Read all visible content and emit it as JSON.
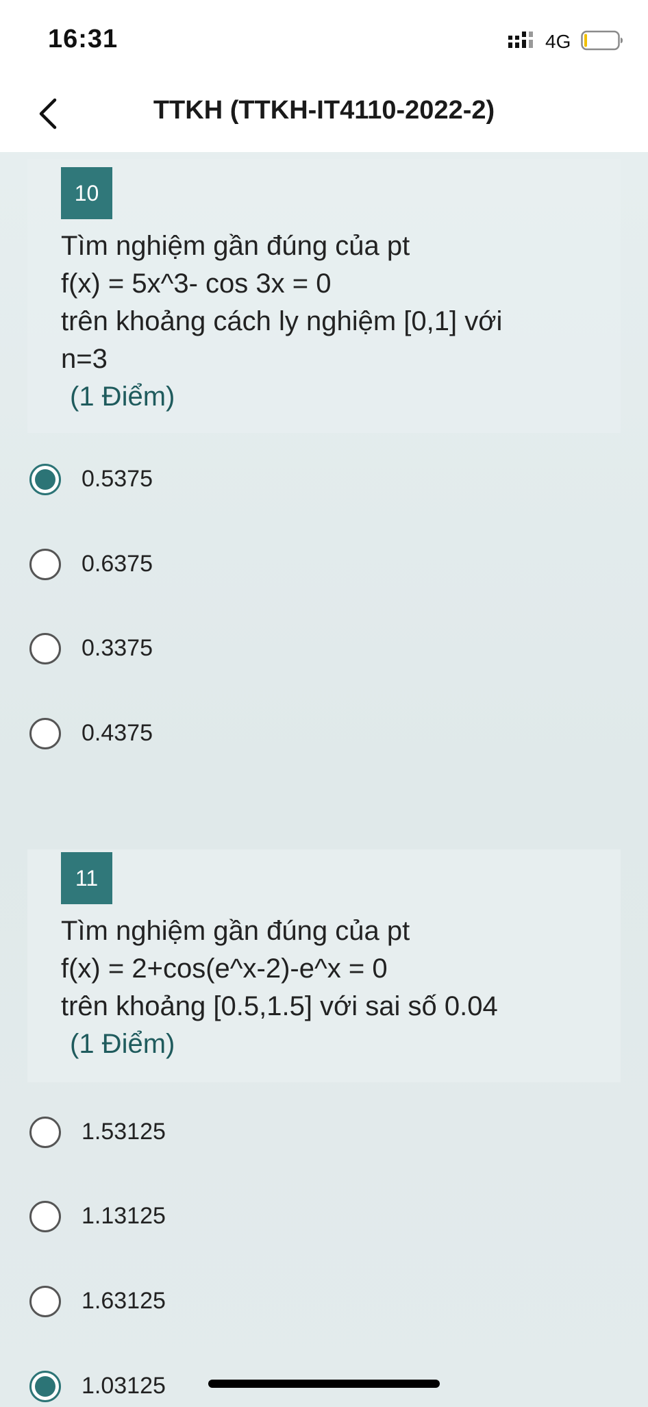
{
  "status_bar": {
    "time": "16:31",
    "network": "4G",
    "icons": [
      "signal-icon",
      "battery-icon"
    ]
  },
  "nav": {
    "back_icon": "chevron-left-icon",
    "title": "TTKH (TTKH-IT4110-2022-2)"
  },
  "questions": [
    {
      "number": "10",
      "lines": [
        "Tìm nghiệm gần đúng của pt",
        "f(x) = 5x^3- cos 3x = 0",
        "trên khoảng cách ly nghiệm [0,1] với",
        "n=3"
      ],
      "points": "(1 Điểm)",
      "options": [
        {
          "label": "0.5375",
          "selected": true
        },
        {
          "label": "0.6375",
          "selected": false
        },
        {
          "label": "0.3375",
          "selected": false
        },
        {
          "label": "0.4375",
          "selected": false
        }
      ]
    },
    {
      "number": "11",
      "lines": [
        "Tìm nghiệm gần đúng của pt",
        "f(x) = 2+cos(e^x-2)-e^x = 0",
        "trên khoảng [0.5,1.5] với sai số 0.04"
      ],
      "points": "(1 Điểm)",
      "options": [
        {
          "label": "1.53125",
          "selected": false
        },
        {
          "label": "1.13125",
          "selected": false
        },
        {
          "label": "1.63125",
          "selected": false
        },
        {
          "label": "1.03125",
          "selected": true
        }
      ]
    }
  ],
  "colors": {
    "accent": "#30787a",
    "background": "#e3ebec",
    "points_text": "#1f5b5d"
  }
}
